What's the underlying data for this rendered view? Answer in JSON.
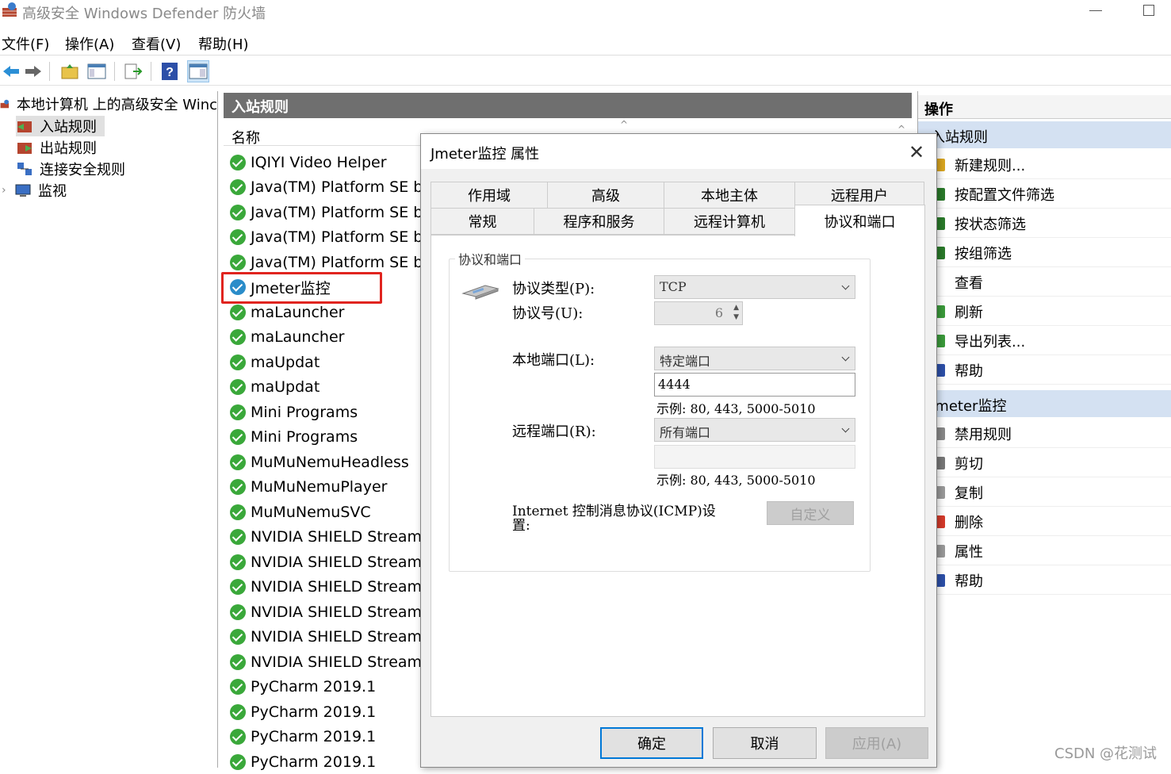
{
  "window": {
    "title": "高级安全 Windows Defender 防火墙"
  },
  "menu": [
    "文件(F)",
    "操作(A)",
    "查看(V)",
    "帮助(H)"
  ],
  "tree": {
    "root": "本地计算机 上的高级安全 Winc",
    "items": [
      "入站规则",
      "出站规则",
      "连接安全规则",
      "监视"
    ]
  },
  "list": {
    "header": "入站规则",
    "column_name": "名称",
    "rows": [
      "IQIYI Video Helper",
      "Java(TM) Platform SE binar",
      "Java(TM) Platform SE binar",
      "Java(TM) Platform SE binar",
      "Java(TM) Platform SE binar",
      "Jmeter监控",
      "maLauncher",
      "maLauncher",
      "maUpdat",
      "maUpdat",
      "Mini Programs",
      "Mini Programs",
      "MuMuNemuHeadless",
      "MuMuNemuPlayer",
      "MuMuNemuSVC",
      "NVIDIA SHIELD Streaming",
      "NVIDIA SHIELD Streaming",
      "NVIDIA SHIELD Streaming",
      "NVIDIA SHIELD Streaming",
      "NVIDIA SHIELD Streaming",
      "NVIDIA SHIELD Streaming",
      "PyCharm 2019.1",
      "PyCharm 2019.1",
      "PyCharm 2019.1",
      "PyCharm 2019.1"
    ]
  },
  "actions": {
    "title": "操作",
    "group1": "入站规则",
    "group1_items": [
      "新建规则...",
      "按配置文件筛选",
      "按状态筛选",
      "按组筛选",
      "查看",
      "刷新",
      "导出列表...",
      "帮助"
    ],
    "group2": "Jmeter监控",
    "group2_items": [
      "禁用规则",
      "剪切",
      "复制",
      "删除",
      "属性",
      "帮助"
    ]
  },
  "dialog": {
    "title": "Jmeter监控 属性",
    "tabs_row1": [
      "作用域",
      "高级",
      "本地主体",
      "远程用户"
    ],
    "tabs_row2": [
      "常规",
      "程序和服务",
      "远程计算机",
      "协议和端口"
    ],
    "group_title": "协议和端口",
    "protocol_type_label": "协议类型(P):",
    "protocol_type_value": "TCP",
    "protocol_number_label": "协议号(U):",
    "protocol_number_value": "6",
    "local_port_label": "本地端口(L):",
    "local_port_value": "特定端口",
    "local_port_input": "4444",
    "local_example": "示例: 80, 443, 5000-5010",
    "remote_port_label": "远程端口(R):",
    "remote_port_value": "所有端口",
    "remote_port_input": "",
    "remote_example": "示例: 80, 443, 5000-5010",
    "icmp_label": "Internet 控制消息协议(ICMP)设置:",
    "customize": "自定义",
    "ok": "确定",
    "cancel": "取消",
    "apply": "应用(A)"
  },
  "watermark": "CSDN @花测试"
}
